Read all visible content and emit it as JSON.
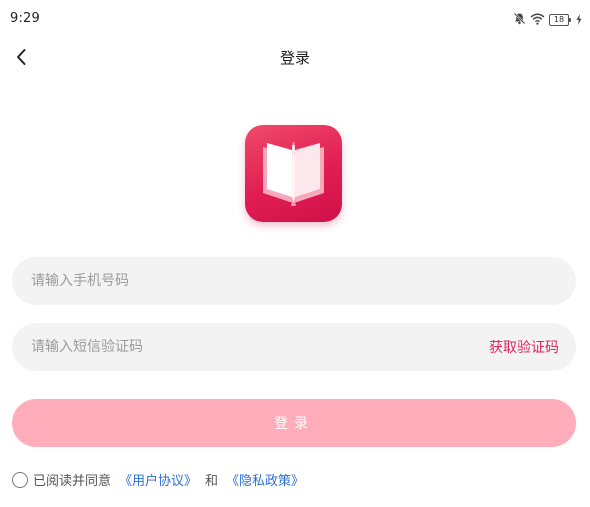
{
  "status_bar": {
    "time": "9:29",
    "battery": "18",
    "icons": [
      "mute-bell-icon",
      "wifi-icon",
      "battery-icon",
      "charging-icon"
    ]
  },
  "header": {
    "title": "登录",
    "back_icon": "chevron-left-icon"
  },
  "logo": {
    "icon": "open-book-icon",
    "color": "#e01e52"
  },
  "form": {
    "phone_placeholder": "请输入手机号码",
    "phone_value": "",
    "code_placeholder": "请输入短信验证码",
    "code_value": "",
    "get_code_label": "获取验证码",
    "login_label": "登录"
  },
  "agreement": {
    "checked": false,
    "prefix": "已阅读并同意",
    "user_agreement": "《用户协议》",
    "conjunction": "和",
    "privacy_policy": "《隐私政策》"
  },
  "colors": {
    "accent": "#e0245e",
    "button_disabled": "#ffacbb",
    "field_background": "#f4f3f4",
    "link": "#2a6fd6"
  }
}
